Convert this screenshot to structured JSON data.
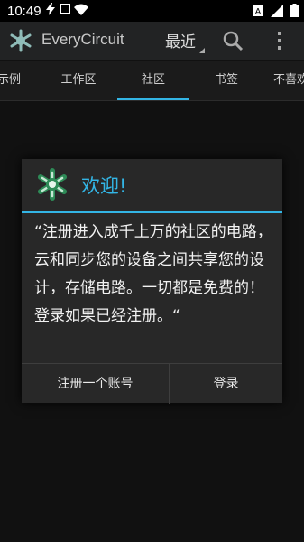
{
  "status_bar": {
    "time": "10:49",
    "icons": [
      "lightning-icon",
      "square-icon",
      "wifi-icon",
      "a-icon",
      "signal-icon",
      "battery-icon"
    ]
  },
  "action_bar": {
    "title": "EveryCircuit",
    "sort_label": "最近"
  },
  "tabs": [
    {
      "label": "示例"
    },
    {
      "label": "工作区"
    },
    {
      "label": "社区",
      "active": true
    },
    {
      "label": "书签"
    },
    {
      "label": "不喜欢"
    }
  ],
  "dialog": {
    "title": "欢迎!",
    "message": "“注册进入成千上万的社区的电路，云和同步您的设备之间共享您的设计，存储电路。一切都是免费的！ 登录如果已经注册。“",
    "buttons": {
      "register": "注册一个账号",
      "login": "登录"
    }
  },
  "colors": {
    "accent": "#33b5e5",
    "actionbar": "#222324",
    "dialog_bg": "#282828",
    "logo_green": "#2e8b57"
  }
}
